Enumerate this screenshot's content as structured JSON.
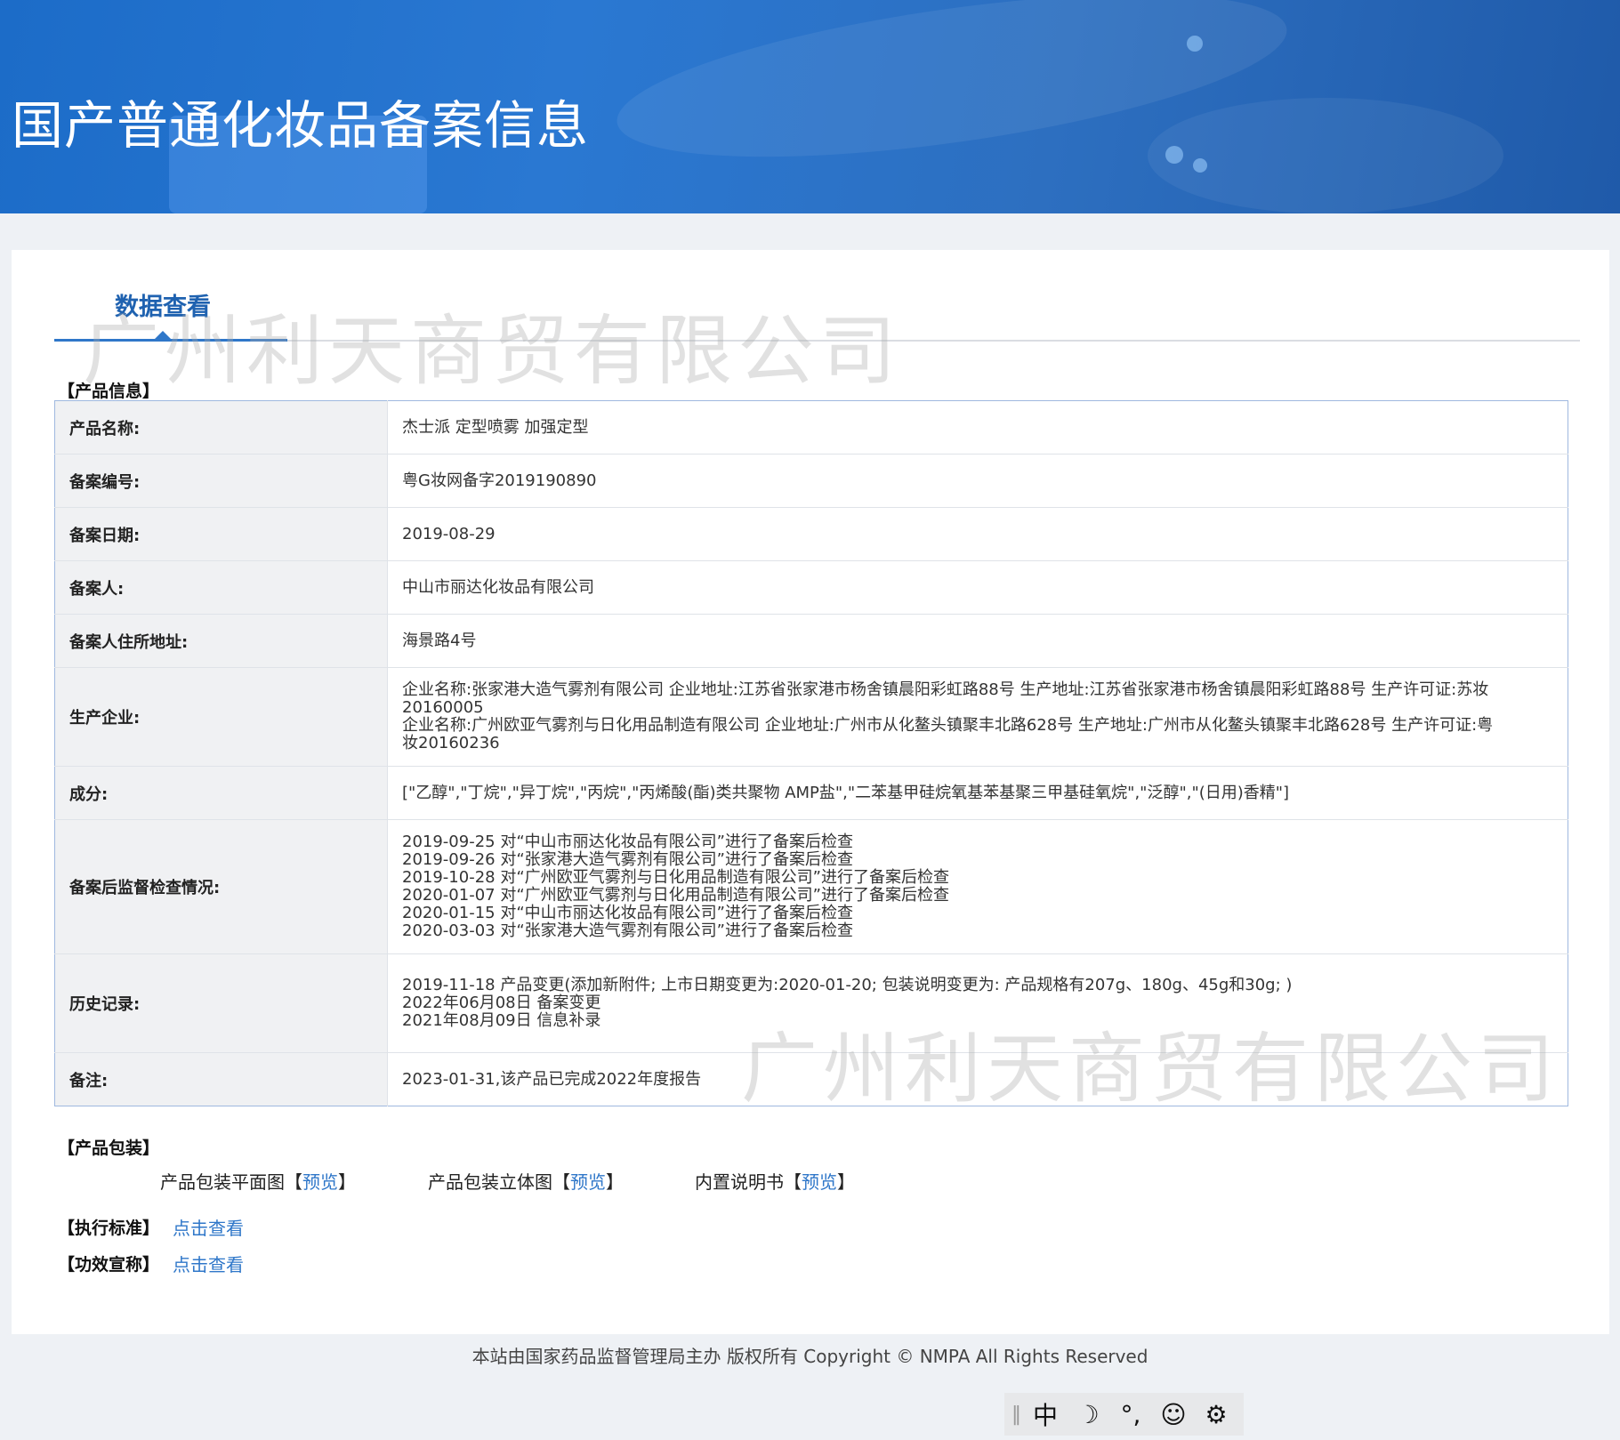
{
  "header": {
    "title": "国产普通化妆品备案信息"
  },
  "tab": {
    "label": "数据查看"
  },
  "watermark": "广州利天商贸有限公司",
  "sections": {
    "product_info": "【产品信息】",
    "packaging": "【产品包装】",
    "standard": "【执行标准】",
    "efficacy": "【功效宣称】"
  },
  "product": {
    "name_label": "产品名称:",
    "name": "杰士派 定型喷雾 加强定型",
    "record_no_label": "备案编号:",
    "record_no": "粤G妆网备字2019190890",
    "record_date_label": "备案日期:",
    "record_date": "2019-08-29",
    "registrant_label": "备案人:",
    "registrant": "中山市丽达化妆品有限公司",
    "address_label": "备案人住所地址:",
    "address": "海景路4号",
    "manufacturer_label": "生产企业:",
    "manufacturers": [
      "企业名称:张家港大造气雾剂有限公司 企业地址:江苏省张家港市杨舍镇晨阳彩虹路88号 生产地址:江苏省张家港市杨舍镇晨阳彩虹路88号 生产许可证:苏妆20160005",
      "企业名称:广州欧亚气雾剂与日化用品制造有限公司 企业地址:广州市从化鳌头镇聚丰北路628号 生产地址:广州市从化鳌头镇聚丰北路628号 生产许可证:粤妆20160236"
    ],
    "ingredients_label": "成分:",
    "ingredients": "[\"乙醇\",\"丁烷\",\"异丁烷\",\"丙烷\",\"丙烯酸(酯)类共聚物 AMP盐\",\"二苯基甲硅烷氧基苯基聚三甲基硅氧烷\",\"泛醇\",\"(日用)香精\"]",
    "inspection_label": "备案后监督检查情况:",
    "inspections": [
      "2019-09-25 对“中山市丽达化妆品有限公司”进行了备案后检查",
      "2019-09-26 对“张家港大造气雾剂有限公司”进行了备案后检查",
      "2019-10-28 对“广州欧亚气雾剂与日化用品制造有限公司”进行了备案后检查",
      "2020-01-07 对“广州欧亚气雾剂与日化用品制造有限公司”进行了备案后检查",
      "2020-01-15 对“中山市丽达化妆品有限公司”进行了备案后检查",
      "2020-03-03 对“张家港大造气雾剂有限公司”进行了备案后检查"
    ],
    "history_label": "历史记录:",
    "history": [
      "2019-11-18 产品变更(添加新附件; 上市日期变更为:2020-01-20; 包装说明变更为: 产品规格有207g、180g、45g和30g; )",
      "2022年06月08日 备案变更",
      "2021年08月09日 信息补录"
    ],
    "remark_label": "备注:",
    "remark": "2023-01-31,该产品已完成2022年度报告"
  },
  "packaging": {
    "flat_label": "产品包装平面图",
    "stereo_label": "产品包装立体图",
    "manual_label": "内置说明书",
    "preview": "预览",
    "bracket_open": "【",
    "bracket_close": "】"
  },
  "links": {
    "view": "点击查看"
  },
  "footer": {
    "text": "本站由国家药品监督管理局主办 版权所有 Copyright © NMPA All Rights Reserved"
  },
  "toolbar": {
    "separator": "‖",
    "lang": "中",
    "moon": "☽",
    "punct": "°,",
    "emoji": "☺",
    "settings": "⚙"
  }
}
